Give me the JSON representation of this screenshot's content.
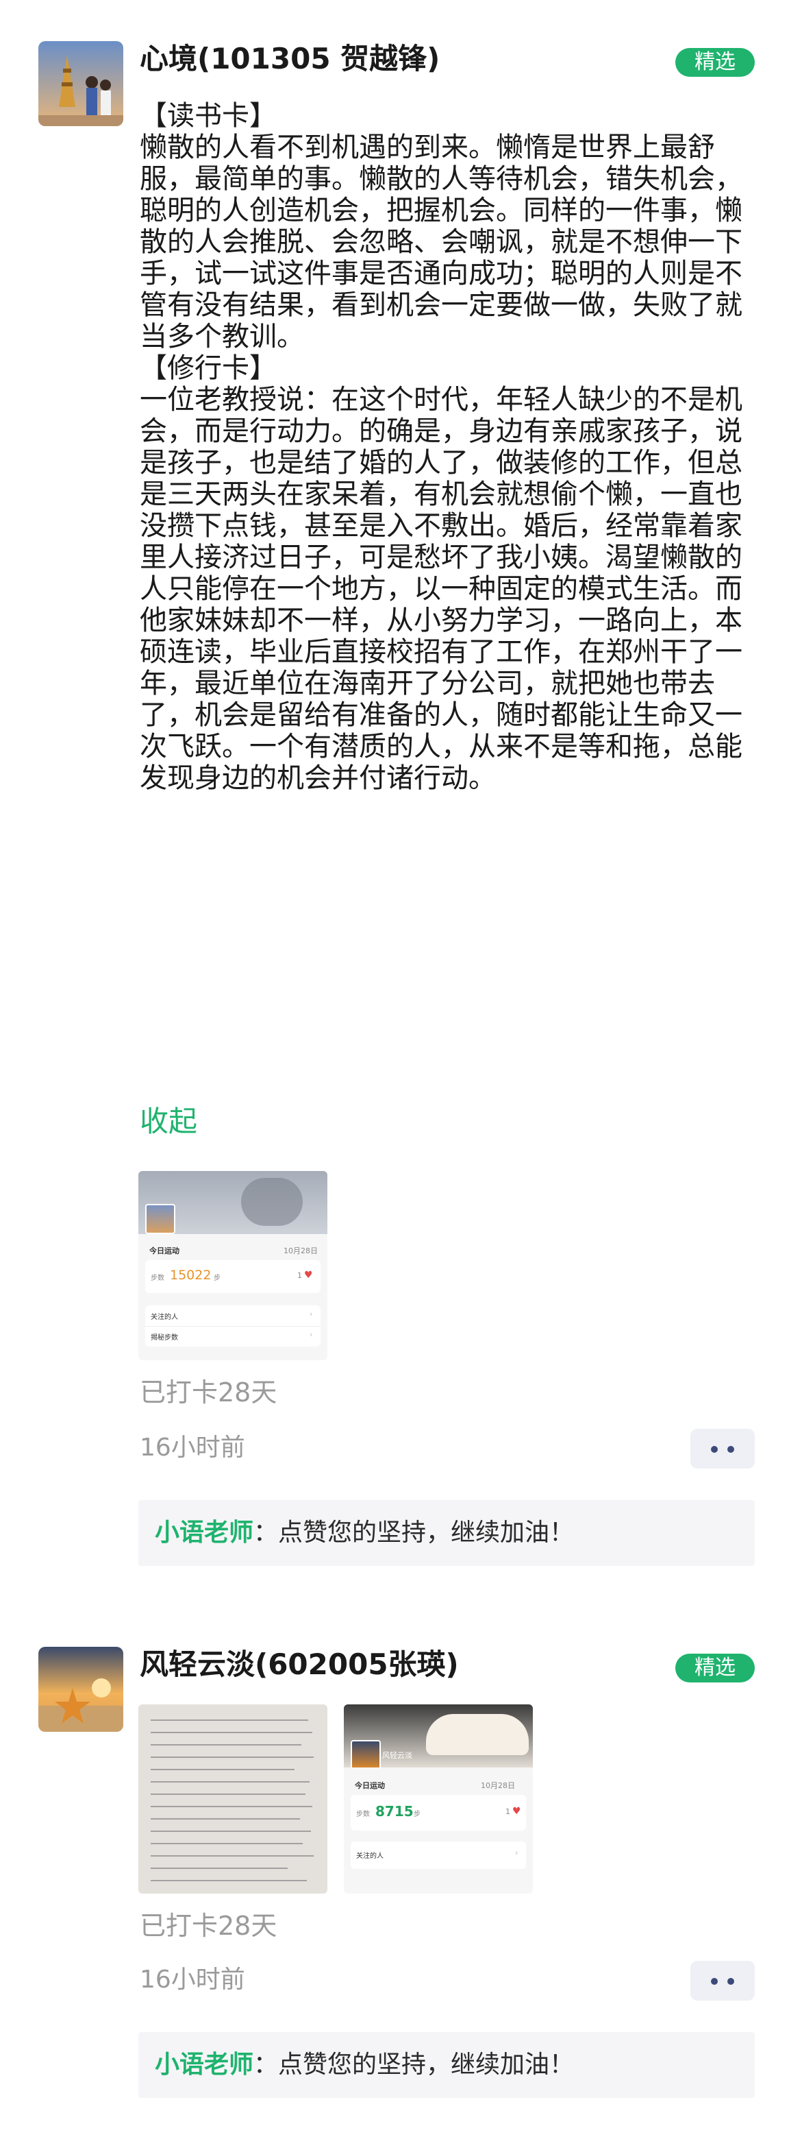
{
  "posts": [
    {
      "name": "心境(101305 贺越锋)",
      "badge": "精选",
      "paragraphs": [
        "【读书卡】",
        "懒散的人看不到机遇的到来。懒惰是世界上最舒服，最简单的事。懒散的人等待机会，错失机会，聪明的人创造机会，把握机会。同样的一件事，懒散的人会推脱、会忽略、会嘲讽，就是不想伸一下手，试一试这件事是否通向成功；聪明的人则是不管有没有结果，看到机会一定要做一做，失败了就当多个教训。",
        "【修行卡】",
        "一位老教授说：在这个时代，年轻人缺少的不是机会，而是行动力。的确是，身边有亲戚家孩子，说是孩子，也是结了婚的人了，做装修的工作，但总是三天两头在家呆着，有机会就想偷个懒，一直也没攒下点钱，甚至是入不敷出。婚后，经常靠着家里人接济过日子，可是愁坏了我小姨。渴望懒散的人只能停在一个地方，以一种固定的模式生活。而他家妹妹却不一样，从小努力学习，一路向上，本硕连读，毕业后直接校招有了工作，在郑州干了一年，最近单位在海南开了分公司，就把她也带去了，机会是留给有准备的人，随时都能让生命又一次飞跃。一个有潜质的人，从来不是等和拖，总能发现身边的机会并付诸行动。"
      ],
      "collapse": "收起",
      "card": {
        "today": "今日运动",
        "date": "10月28日",
        "steps_label": "步数",
        "steps": "15022",
        "steps_unit": "步",
        "likes": "1",
        "follow": "关注的人",
        "ranking": "揭秘步数"
      },
      "checkin": "已打卡28天",
      "time": "16小时前",
      "comment_author": "小语老师",
      "comment_text": "：点赞您的坚持，继续加油！"
    },
    {
      "name": "风轻云淡(602005张瑛)",
      "badge": "精选",
      "card": {
        "user": "风轻云淡",
        "today": "今日运动",
        "date": "10月28日",
        "steps_label": "步数",
        "steps": "8715",
        "steps_unit": "步",
        "likes": "1",
        "follow": "关注的人"
      },
      "checkin": "已打卡28天",
      "time": "16小时前",
      "comment_author": "小语老师",
      "comment_text": "：点赞您的坚持，继续加油！"
    }
  ],
  "colors": {
    "accent": "#1fb36e",
    "more_dots": "#3d4a79"
  }
}
